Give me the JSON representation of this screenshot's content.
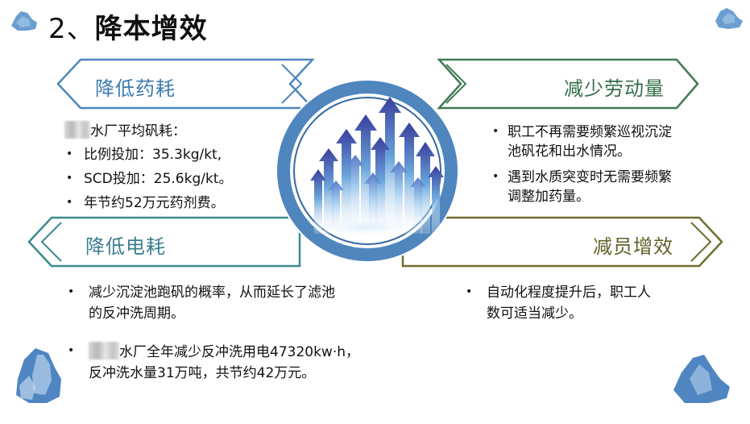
{
  "title": {
    "number": "2、",
    "text": "降本增效"
  },
  "sections": {
    "reduce_chemicals": {
      "heading": "降低药耗"
    },
    "reduce_labor": {
      "heading": "减少劳动量"
    },
    "reduce_power": {
      "heading": "降低电耗"
    },
    "reduce_staff": {
      "heading": "减员增效"
    }
  },
  "chemicals": {
    "intro": "水厂平均矾耗：",
    "items": [
      "比例投加：35.3kg/kt,",
      "SCD投加：25.6kg/kt。",
      "年节约52万元药剂费。"
    ]
  },
  "labor": {
    "item1_line1": "职工不再需要频繁巡视沉淀",
    "item1_line2": "池矾花和出水情况。",
    "item2_line1": "遇到水质突变时无需要频繁",
    "item2_line2": "调整加药量。"
  },
  "power": {
    "item1_line1": "减少沉淀池跑矾的概率，从而延长了滤池",
    "item1_line2": "的反冲洗周期。",
    "item2_line1": "水厂全年减少反冲洗用电47320kw·h，",
    "item2_line2": "反冲洗水量31万吨，共节约42万元。"
  },
  "staff": {
    "item1_line1": "自动化程度提升后，职工人",
    "item1_line2": "数可适当减少。"
  },
  "colors": {
    "blue": "#3e7bb0",
    "green": "#356e48",
    "olive": "#5f6128",
    "teal": "#3c7e8e",
    "ring": "#4e86bd"
  },
  "icons": {
    "center": "rising-arrows-image",
    "corners": "cloud-decoration"
  }
}
